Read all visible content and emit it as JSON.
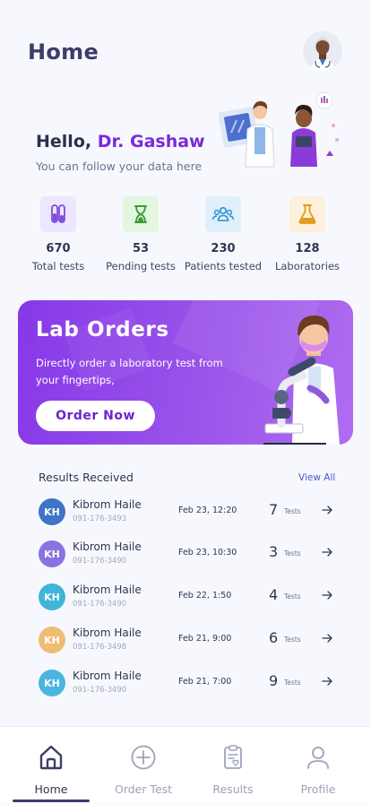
{
  "header": {
    "title": "Home"
  },
  "greeting": {
    "hello": "Hello,",
    "name": "Dr. Gashaw",
    "subtitle": "You can follow your data here"
  },
  "stats": [
    {
      "value": "670",
      "label": "Total tests",
      "icon": "test-tubes-icon",
      "bg": "#ece7ff",
      "color": "#7c4ddb"
    },
    {
      "value": "53",
      "label": "Pending tests",
      "icon": "hourglass-icon",
      "bg": "#e3f6df",
      "color": "#3a9b3a"
    },
    {
      "value": "230",
      "label": "Patients tested",
      "icon": "people-icon",
      "bg": "#dff0fb",
      "color": "#2c8fcb"
    },
    {
      "value": "128",
      "label": "Laboratories",
      "icon": "flask-icon",
      "bg": "#fdf0dc",
      "color": "#e29b1f"
    }
  ],
  "banner": {
    "title": "Lab Orders",
    "subtitle": "Directly order a laboratory test from your fingertips,",
    "button": "Order Now"
  },
  "results": {
    "title": "Results Received",
    "view_all": "View All",
    "tests_label": "Tests",
    "rows": [
      {
        "initials": "KH",
        "name": "Kibrom Haile",
        "phone": "091-176-3493",
        "date": "Feb 23, 12:20",
        "count": "7",
        "color": "#3f74c9"
      },
      {
        "initials": "KH",
        "name": "Kibrom Haile",
        "phone": "091-176-3490",
        "date": "Feb 23, 10:30",
        "count": "3",
        "color": "#8a72e0"
      },
      {
        "initials": "KH",
        "name": "Kibrom Haile",
        "phone": "091-176-3490",
        "date": "Feb 22, 1:50",
        "count": "4",
        "color": "#3fb5d8"
      },
      {
        "initials": "KH",
        "name": "Kibrom Haile",
        "phone": "091-176-3498",
        "date": "Feb 21, 9:00",
        "count": "6",
        "color": "#eebd74"
      },
      {
        "initials": "KH",
        "name": "Kibrom Haile",
        "phone": "091-176-3490",
        "date": "Feb 21, 7:00",
        "count": "9",
        "color": "#4ab6e0"
      }
    ]
  },
  "nav": [
    {
      "label": "Home",
      "icon": "home-icon",
      "active": true
    },
    {
      "label": "Order Test",
      "icon": "plus-circle-icon",
      "active": false
    },
    {
      "label": "Results",
      "icon": "clipboard-icon",
      "active": false
    },
    {
      "label": "Profile",
      "icon": "user-icon",
      "active": false
    }
  ]
}
